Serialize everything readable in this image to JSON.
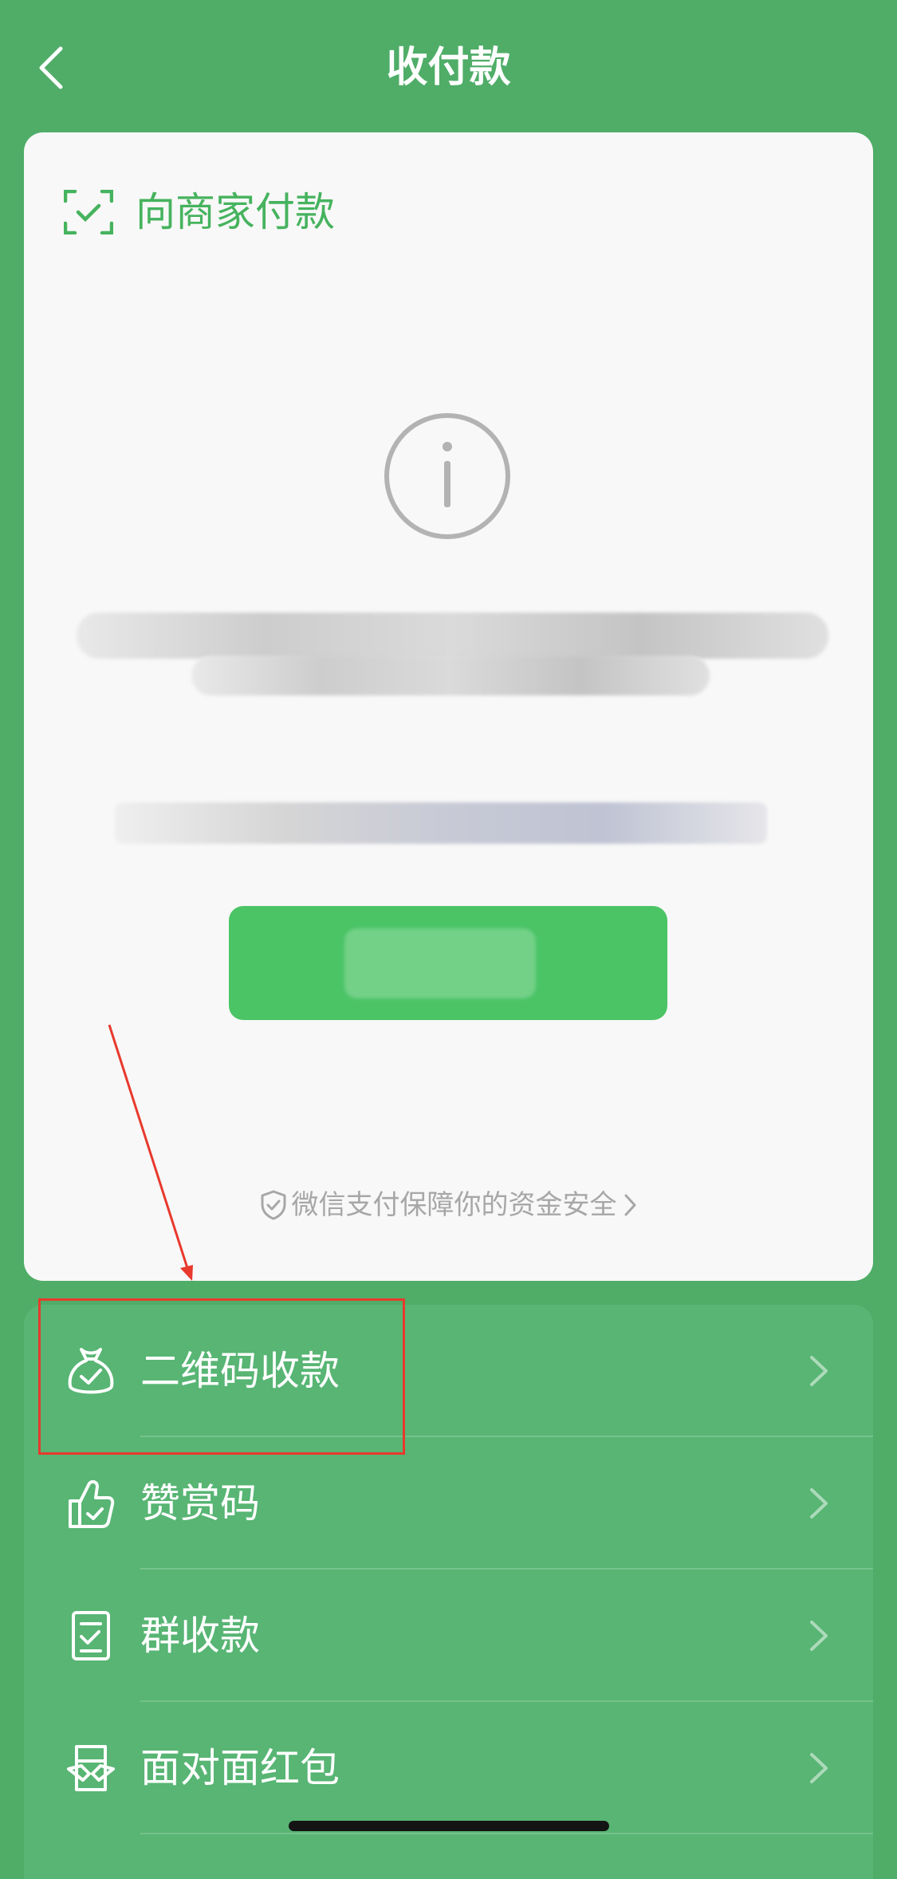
{
  "header": {
    "title": "收付款"
  },
  "card": {
    "pay_merchant_label": "向商家付款",
    "safety_text": "微信支付保障你的资金安全"
  },
  "menu": {
    "items": [
      {
        "label": "二维码收款"
      },
      {
        "label": "赞赏码"
      },
      {
        "label": "群收款"
      },
      {
        "label": "面对面红包"
      }
    ]
  },
  "colors": {
    "background": "#4fad67",
    "card": "#f8f8f8",
    "accent": "#46b35e",
    "button": "#4bc466",
    "annotation": "#e8392d"
  }
}
